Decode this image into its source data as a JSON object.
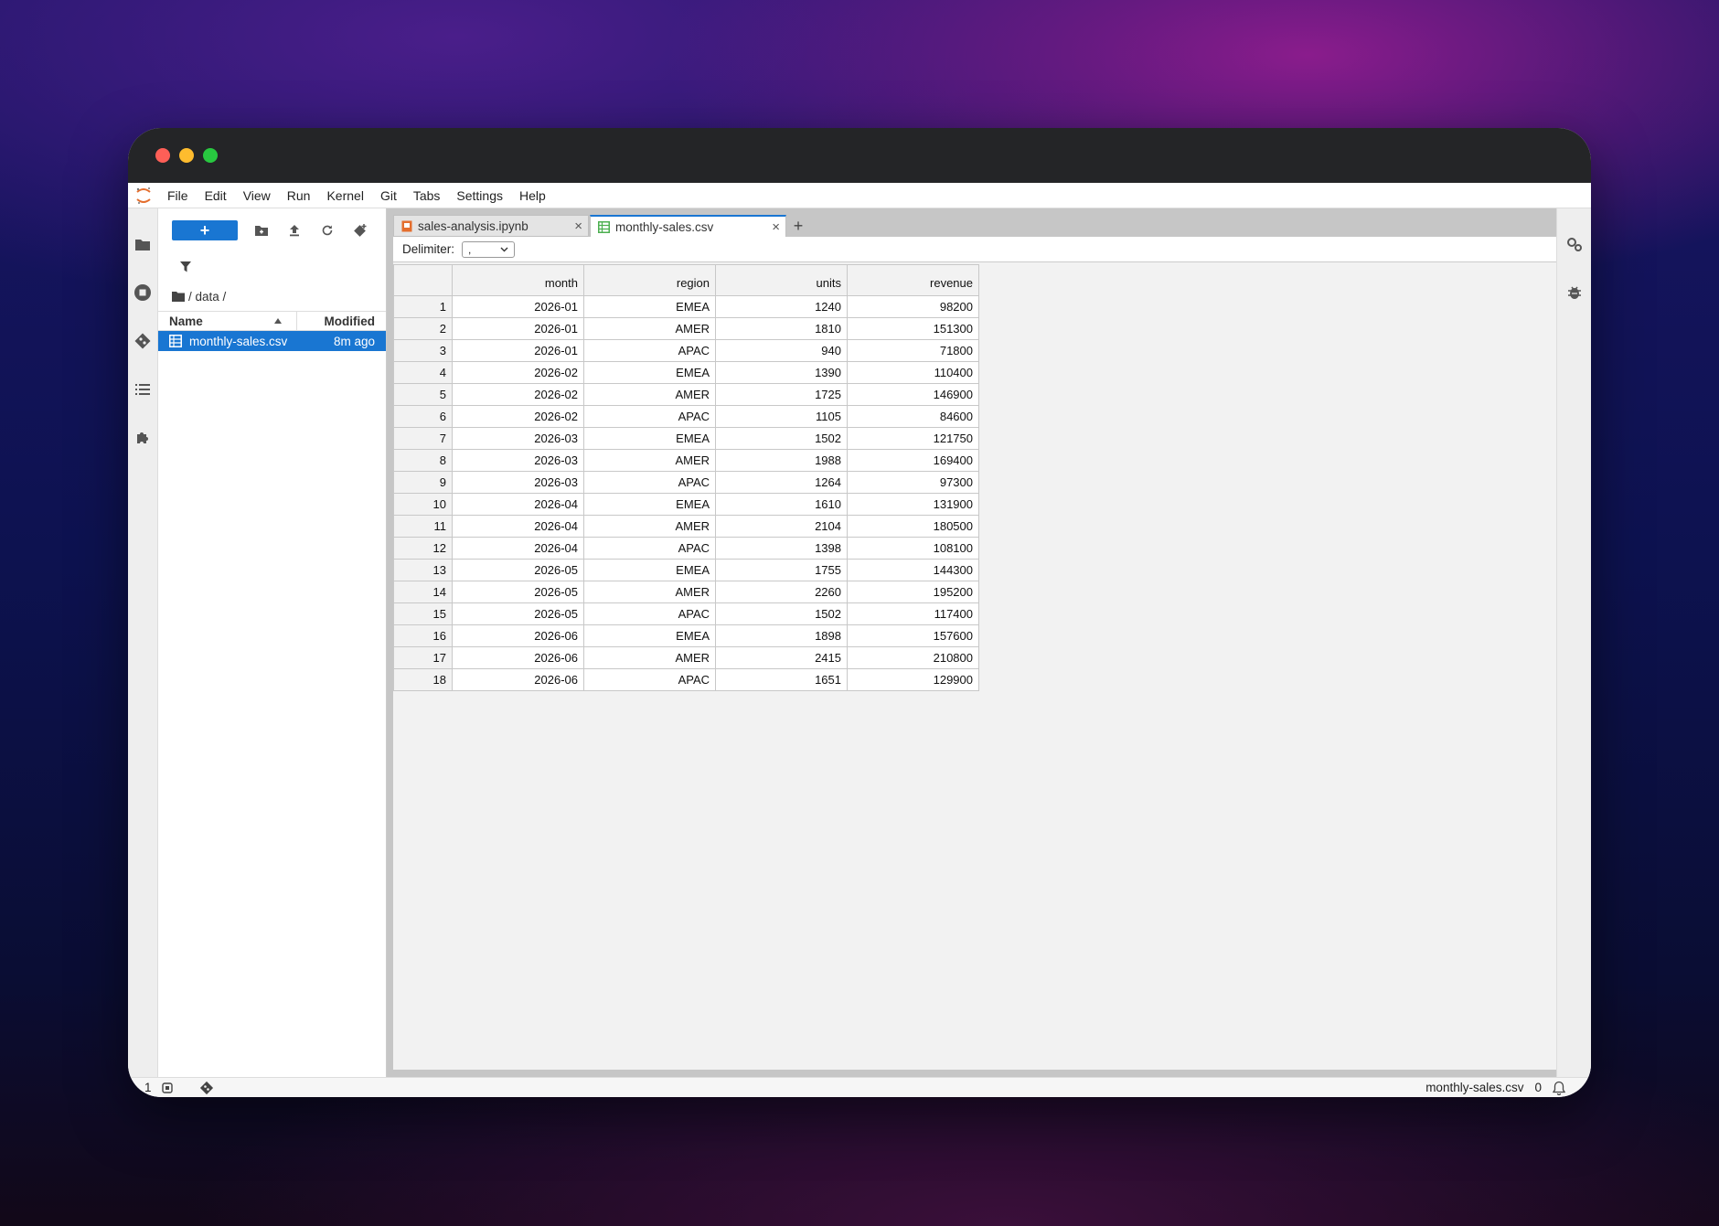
{
  "menu": [
    "File",
    "Edit",
    "View",
    "Run",
    "Kernel",
    "Git",
    "Tabs",
    "Settings",
    "Help"
  ],
  "filebrowser": {
    "new_label": "+",
    "breadcrumb": "/ data /",
    "col_name": "Name",
    "col_modified": "Modified",
    "files": [
      {
        "name": "monthly-sales.csv",
        "modified": "8m ago"
      }
    ]
  },
  "tabs": [
    {
      "label": "sales-analysis.ipynb",
      "close": "×"
    },
    {
      "label": "monthly-sales.csv",
      "close": "×"
    }
  ],
  "add_tab_label": "+",
  "csv": {
    "delimiter_label": "Delimiter:",
    "delimiter_value": ",",
    "columns": [
      "month",
      "region",
      "units",
      "revenue"
    ],
    "rows": [
      [
        "1",
        "2026-01",
        "EMEA",
        "1240",
        "98200"
      ],
      [
        "2",
        "2026-01",
        "AMER",
        "1810",
        "151300"
      ],
      [
        "3",
        "2026-01",
        "APAC",
        "940",
        "71800"
      ],
      [
        "4",
        "2026-02",
        "EMEA",
        "1390",
        "110400"
      ],
      [
        "5",
        "2026-02",
        "AMER",
        "1725",
        "146900"
      ],
      [
        "6",
        "2026-02",
        "APAC",
        "1105",
        "84600"
      ],
      [
        "7",
        "2026-03",
        "EMEA",
        "1502",
        "121750"
      ],
      [
        "8",
        "2026-03",
        "AMER",
        "1988",
        "169400"
      ],
      [
        "9",
        "2026-03",
        "APAC",
        "1264",
        "97300"
      ],
      [
        "10",
        "2026-04",
        "EMEA",
        "1610",
        "131900"
      ],
      [
        "11",
        "2026-04",
        "AMER",
        "2104",
        "180500"
      ],
      [
        "12",
        "2026-04",
        "APAC",
        "1398",
        "108100"
      ],
      [
        "13",
        "2026-05",
        "EMEA",
        "1755",
        "144300"
      ],
      [
        "14",
        "2026-05",
        "AMER",
        "2260",
        "195200"
      ],
      [
        "15",
        "2026-05",
        "APAC",
        "1502",
        "117400"
      ],
      [
        "16",
        "2026-06",
        "EMEA",
        "1898",
        "157600"
      ],
      [
        "17",
        "2026-06",
        "AMER",
        "2415",
        "210800"
      ],
      [
        "18",
        "2026-06",
        "APAC",
        "1651",
        "129900"
      ]
    ]
  },
  "status": {
    "left_count": "1",
    "filename": "monthly-sales.csv",
    "notifications": "0"
  },
  "colors": {
    "accent": "#1976d2",
    "titlebar": "#242527",
    "notebook_icon": "#e46e2e",
    "csv_icon": "#4caf50"
  }
}
